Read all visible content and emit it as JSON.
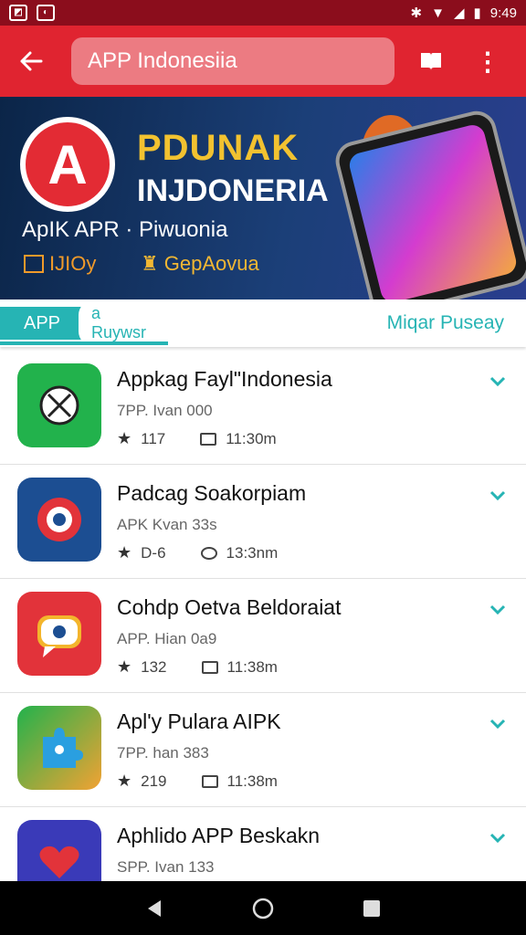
{
  "status_bar": {
    "time": "9:49"
  },
  "toolbar": {
    "search_value": "APP Indonesiia"
  },
  "banner": {
    "title_line1": "PDUNAK",
    "title_line2": "INJDONERIA",
    "subtitle": "ApIK APR · Piwuonia",
    "chip1": "IJIOy",
    "chip2": "GepAovua"
  },
  "tabs": {
    "left_label": "APP",
    "left_inner": "a Ruywsr",
    "right_label": "Miqar Puseay"
  },
  "apps": [
    {
      "name": "Appkag Fayl\"Indonesia",
      "sub": "7PP. Ivan 000",
      "rating": "117",
      "reviews": "11:30m",
      "icon": "robot-icon",
      "color": "#22b24c"
    },
    {
      "name": "Padcag Soakorpiam",
      "sub": "APK Kvan 33s",
      "rating": "D-6",
      "reviews": "13:3nm",
      "icon": "target-icon",
      "color": "#1c4e92"
    },
    {
      "name": "Cohdp Oetva Beldoraiat",
      "sub": "APP. Hian 0a9",
      "rating": "132",
      "reviews": "11:38m",
      "icon": "chat-icon",
      "color": "#e2333a"
    },
    {
      "name": "Apl'y Pulara AIPK",
      "sub": "7PP. han 383",
      "rating": "219",
      "reviews": "11:38m",
      "icon": "puzzle-icon",
      "color": "#f2a233"
    },
    {
      "name": "Aphlido APP Beskakn",
      "sub": "SPP. Ivan 133",
      "rating": "",
      "reviews": "",
      "icon": "heart-icon",
      "color": "#3a3ab8"
    }
  ]
}
